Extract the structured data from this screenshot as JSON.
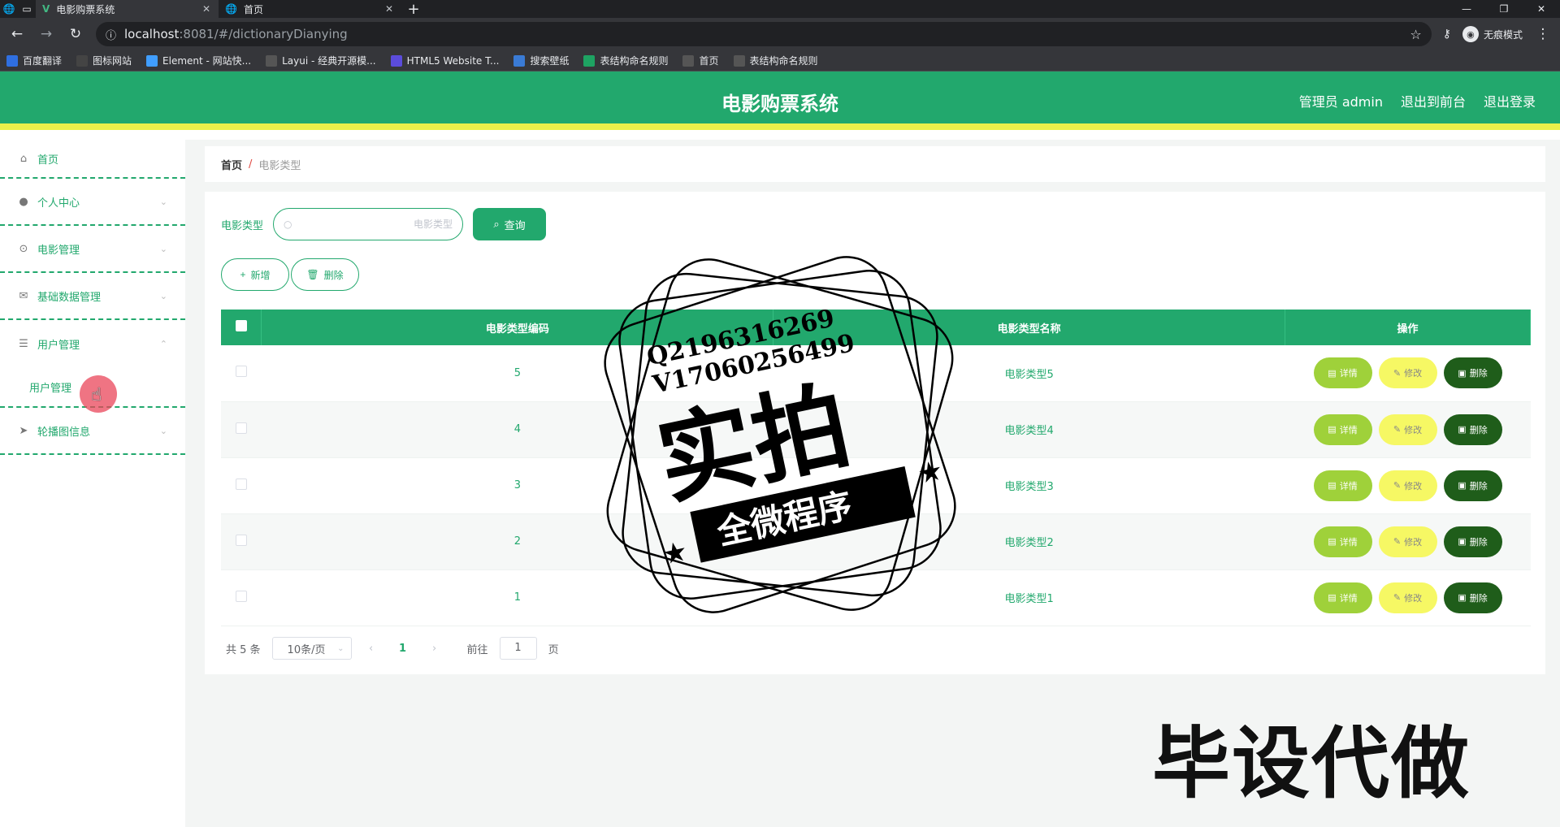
{
  "browser": {
    "tabs": [
      {
        "title": "电影购票系统",
        "active": true
      },
      {
        "title": "首页",
        "active": false
      }
    ],
    "url_host": "localhost",
    "url_path": ":8081/#/dictionaryDianying",
    "profile_label": "无痕模式",
    "bookmarks": [
      {
        "label": "百度翻译",
        "color": "#2f6fe0"
      },
      {
        "label": "图标网站",
        "color": "#444"
      },
      {
        "label": "Element - 网站快...",
        "color": "#409eff"
      },
      {
        "label": "Layui - 经典开源模...",
        "color": "#555"
      },
      {
        "label": "HTML5 Website T...",
        "color": "#5b4cdb"
      },
      {
        "label": "搜索壁纸",
        "color": "#3a7bd5"
      },
      {
        "label": "表结构命名规则",
        "color": "#1ea362"
      },
      {
        "label": "首页",
        "color": "#555"
      },
      {
        "label": "表结构命名规则",
        "color": "#555"
      }
    ]
  },
  "header": {
    "title": "电影购票系统",
    "links": [
      "管理员 admin",
      "退出到前台",
      "退出登录"
    ]
  },
  "sidebar": {
    "items": [
      {
        "label": "首页",
        "icon": "home-icon"
      },
      {
        "label": "个人中心",
        "icon": "user-icon"
      },
      {
        "label": "电影管理",
        "icon": "mic-icon"
      },
      {
        "label": "基础数据管理",
        "icon": "mail-icon"
      },
      {
        "label": "用户管理",
        "icon": "menu-icon"
      },
      {
        "label": "轮播图信息",
        "icon": "send-icon"
      }
    ],
    "sub_item": "用户管理"
  },
  "breadcrumb": {
    "home": "首页",
    "separator": "/",
    "current": "电影类型"
  },
  "search": {
    "label": "电影类型",
    "placeholder": "电影类型",
    "button": "查询"
  },
  "actions": {
    "add": "新增",
    "delete": "删除"
  },
  "table": {
    "headers": [
      "电影类型编码",
      "电影类型名称",
      "操作"
    ],
    "rows": [
      {
        "code": "5",
        "name": "电影类型5"
      },
      {
        "code": "4",
        "name": "电影类型4"
      },
      {
        "code": "3",
        "name": "电影类型3"
      },
      {
        "code": "2",
        "name": "电影类型2"
      },
      {
        "code": "1",
        "name": "电影类型1"
      }
    ],
    "ops": {
      "detail": "详情",
      "edit": "修改",
      "delete": "删除"
    }
  },
  "pagination": {
    "total": "共 5 条",
    "page_size": "10条/页",
    "current_page": "1",
    "goto_label": "前往",
    "goto_value": "1",
    "page_suffix": "页"
  },
  "watermark": {
    "line1": "Q2196316269",
    "line2": "V17060256499",
    "big": "实拍",
    "banner": "全微程序",
    "corner": "毕设代做"
  },
  "colors": {
    "primary": "#22a86d",
    "accent_bar": "#ecf04a",
    "detail": "#9fd13a",
    "edit": "#f6f864",
    "delete": "#1f5d1a"
  }
}
